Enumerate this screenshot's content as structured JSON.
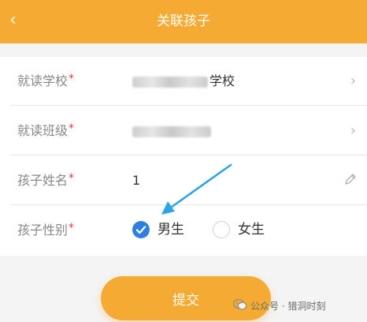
{
  "header": {
    "back_icon": "chevron-left-icon",
    "title": "关联孩子"
  },
  "form": {
    "school": {
      "label": "就读学校",
      "required": "*",
      "value_visible": "学校"
    },
    "class": {
      "label": "就读班级",
      "required": "*"
    },
    "child_name": {
      "label": "孩子姓名",
      "required": "*",
      "value": "1"
    },
    "gender": {
      "label": "孩子性别",
      "required": "*",
      "options": [
        {
          "label": "男生",
          "selected": true
        },
        {
          "label": "女生",
          "selected": false
        }
      ]
    }
  },
  "submit_label": "提交",
  "watermark": "公众号 · 猎洞时刻",
  "colors": {
    "brand": "#f5ab33",
    "radio_selected": "#2f7fe0",
    "arrow": "#2fa3e6",
    "required": "#e23b3b"
  }
}
